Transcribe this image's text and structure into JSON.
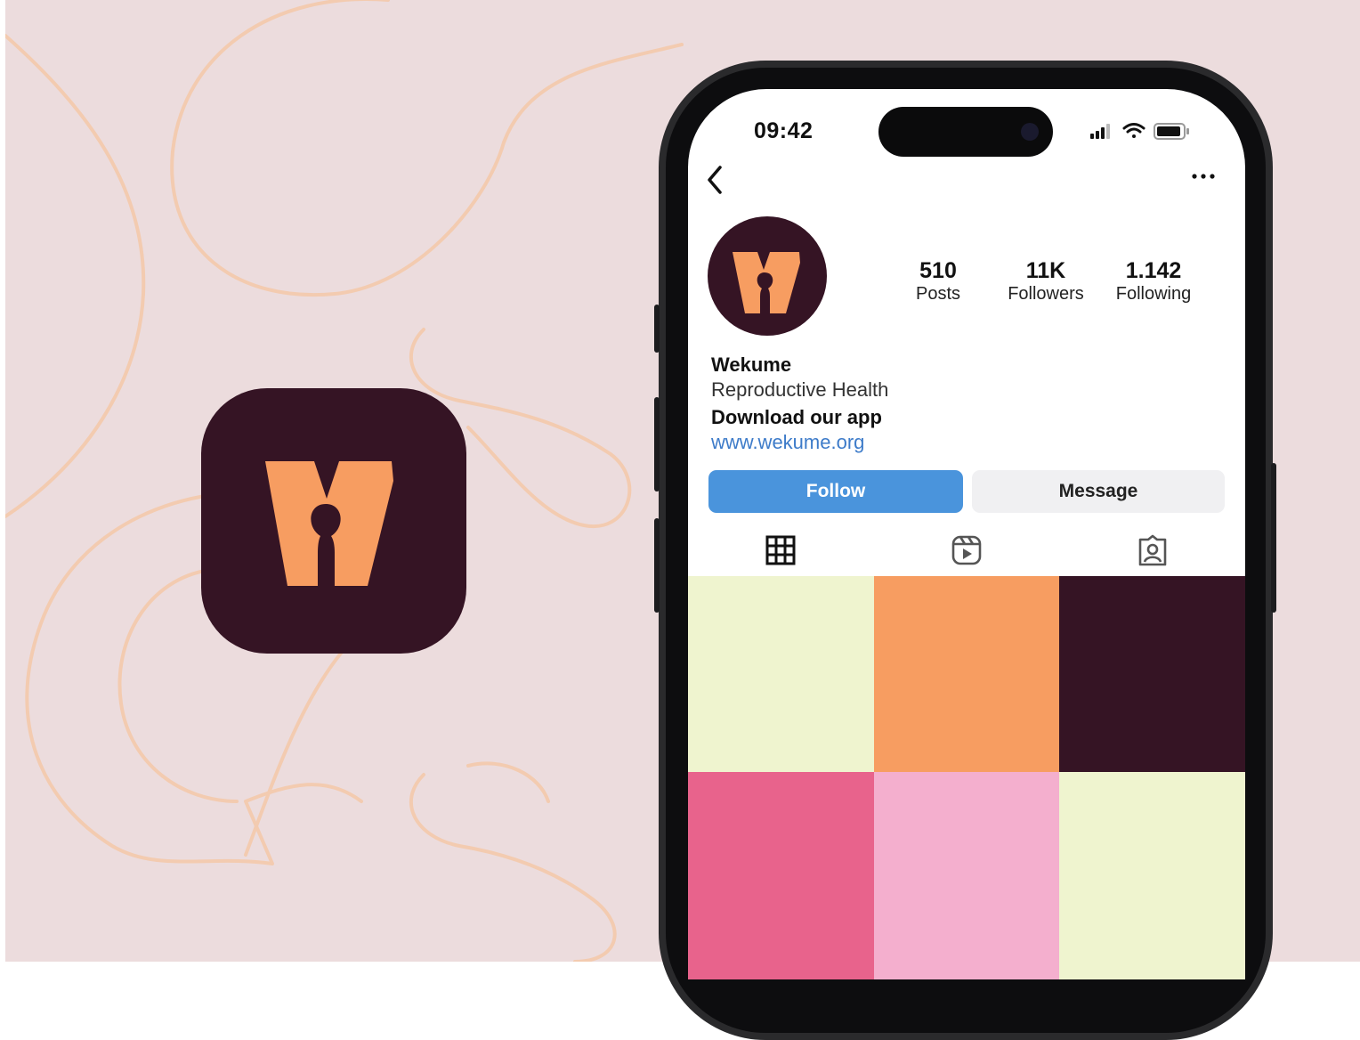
{
  "brand": {
    "logo_letter": "W",
    "colors": {
      "background": "#ecdcdd",
      "maroon": "#351424",
      "orange": "#f79d61",
      "cream": "#eff4cf",
      "pink": "#e8638c",
      "light_pink": "#f4afce",
      "link_blue": "#3d7bc9",
      "follow_blue": "#4a94dc"
    }
  },
  "status_bar": {
    "time": "09:42",
    "icons": [
      "signal-icon",
      "wifi-icon",
      "battery-icon"
    ]
  },
  "nav": {
    "back_icon": "chevron-left-icon",
    "more_icon": "more-horizontal-icon"
  },
  "profile": {
    "stats": [
      {
        "value": "510",
        "label": "Posts"
      },
      {
        "value": "11K",
        "label": "Followers"
      },
      {
        "value": "1.142",
        "label": "Following"
      }
    ],
    "name": "Wekume",
    "category": "Reproductive Health",
    "cta": "Download our app",
    "link": "www.wekume.org"
  },
  "actions": {
    "follow_label": "Follow",
    "message_label": "Message"
  },
  "tabs": [
    {
      "icon": "grid-icon",
      "active": true
    },
    {
      "icon": "reels-icon",
      "active": false
    },
    {
      "icon": "tagged-icon",
      "active": false
    }
  ],
  "posts": [
    {
      "color": "#eff4cf"
    },
    {
      "color": "#f79d61"
    },
    {
      "color": "#351424"
    },
    {
      "color": "#e8638c"
    },
    {
      "color": "#f4afce"
    },
    {
      "color": "#eff4cf"
    }
  ]
}
